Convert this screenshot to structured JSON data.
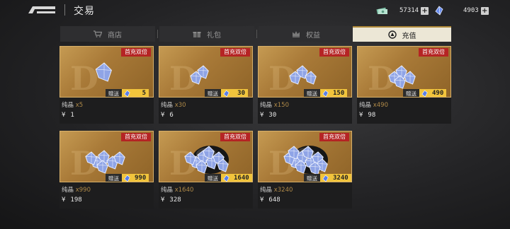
{
  "header": {
    "title": "交易"
  },
  "resources": [
    {
      "name": "coin",
      "value": "57314",
      "icon": "money-icon"
    },
    {
      "name": "crystal",
      "value": "4903",
      "icon": "crystal-icon"
    }
  ],
  "tabs": [
    {
      "label": "商店",
      "icon": "cart-icon",
      "active": false
    },
    {
      "label": "礼包",
      "icon": "gift-box-icon",
      "active": false
    },
    {
      "label": "权益",
      "icon": "crown-icon",
      "active": false
    },
    {
      "label": "充值",
      "icon": "target-icon",
      "active": true
    }
  ],
  "badge_text": "首充双倍",
  "gift_label": "赠送",
  "currency_symbol": "¥",
  "products": [
    {
      "name": "纯晶",
      "qty": "x5",
      "bonus": "5",
      "price": "1"
    },
    {
      "name": "纯晶",
      "qty": "x30",
      "bonus": "30",
      "price": "6"
    },
    {
      "name": "纯晶",
      "qty": "x150",
      "bonus": "150",
      "price": "30"
    },
    {
      "name": "纯晶",
      "qty": "x490",
      "bonus": "490",
      "price": "98"
    },
    {
      "name": "纯晶",
      "qty": "x990",
      "bonus": "990",
      "price": "198"
    },
    {
      "name": "纯晶",
      "qty": "x1640",
      "bonus": "1640",
      "price": "328"
    },
    {
      "name": "纯晶",
      "qty": "x3240",
      "bonus": "3240",
      "price": "648"
    }
  ],
  "colors": {
    "card_gold": "#b0843e",
    "badge_red": "#b52424",
    "gift_yellow": "#f1c43c"
  }
}
